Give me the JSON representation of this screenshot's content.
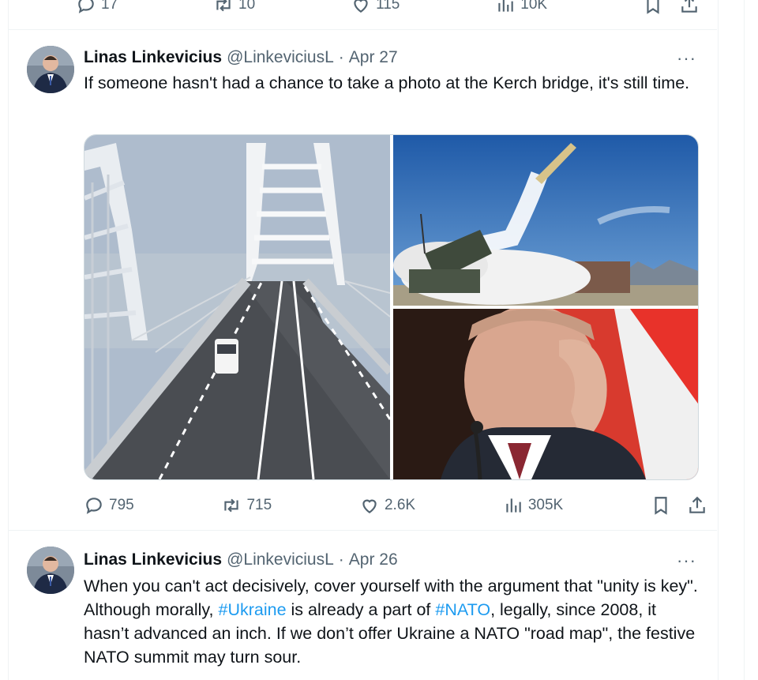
{
  "top_actions": {
    "replies": "17",
    "retweets": "10",
    "likes": "115",
    "views": "10K"
  },
  "tweet1": {
    "name": "Linas Linkevicius",
    "handle": "@LinkeviciusL",
    "dot": "·",
    "time": "Apr 27",
    "more": "···",
    "text": "If someone hasn't had a chance to take a photo at the Kerch bridge, it's still time.",
    "media": [
      "bridge-photo",
      "missile-launch-photo",
      "putin-photo"
    ],
    "actions": {
      "replies": "795",
      "retweets": "715",
      "likes": "2.6K",
      "views": "305K"
    }
  },
  "tweet2": {
    "name": "Linas Linkevicius",
    "handle": "@LinkeviciusL",
    "dot": "·",
    "time": "Apr 26",
    "more": "···",
    "text_parts": {
      "p1": "When you can't act decisively, cover yourself with the argument that \"unity is key\". Although morally, ",
      "tag1": "#Ukraine",
      "p2": " is already a part of ",
      "tag2": "#NATO",
      "p3": ", legally, since 2008, it hasn’t advanced an inch. If we don’t offer Ukraine a NATO \"road map\", the festive NATO summit may turn sour."
    }
  },
  "colors": {
    "accent": "#1d9bf0",
    "text": "#0f1419",
    "muted": "#536471",
    "border": "#eff3f4"
  },
  "icons": [
    "reply-icon",
    "retweet-icon",
    "like-icon",
    "views-icon",
    "bookmark-icon",
    "share-icon",
    "more-icon"
  ]
}
